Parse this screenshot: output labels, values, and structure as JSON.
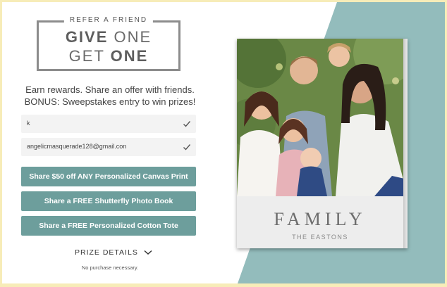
{
  "hero": {
    "label": "REFER A FRIEND",
    "line1_light_a": "GIVE",
    "line1_light_b": " ONE",
    "line2_light": "GET ",
    "line2_bold": "ONE"
  },
  "subtext": {
    "line1": "Earn rewards. Share an offer with friends.",
    "line2": "BONUS: Sweepstakes entry to win prizes!"
  },
  "fields": {
    "name_value": "k",
    "email_value": "angelicmasquerade128@gmail.con"
  },
  "buttons": {
    "canvas_offer": "Share $50 off ANY Personalized Canvas Print",
    "photo_book_offer": "Share a FREE Shutterfly Photo Book",
    "tote_offer": "Share a FREE Personalized Cotton Tote"
  },
  "prize_details": "PRIZE DETAILS",
  "disclaimer": "No purchase necessary.",
  "product": {
    "title": "FAMILY",
    "subtitle": "THE EASTONS"
  },
  "colors": {
    "button": "#6d9e9c",
    "teal_panel": "#93bcbc",
    "border_frame": "#f7ecb8"
  },
  "icons": [
    "check-icon",
    "chevron-down-icon"
  ]
}
